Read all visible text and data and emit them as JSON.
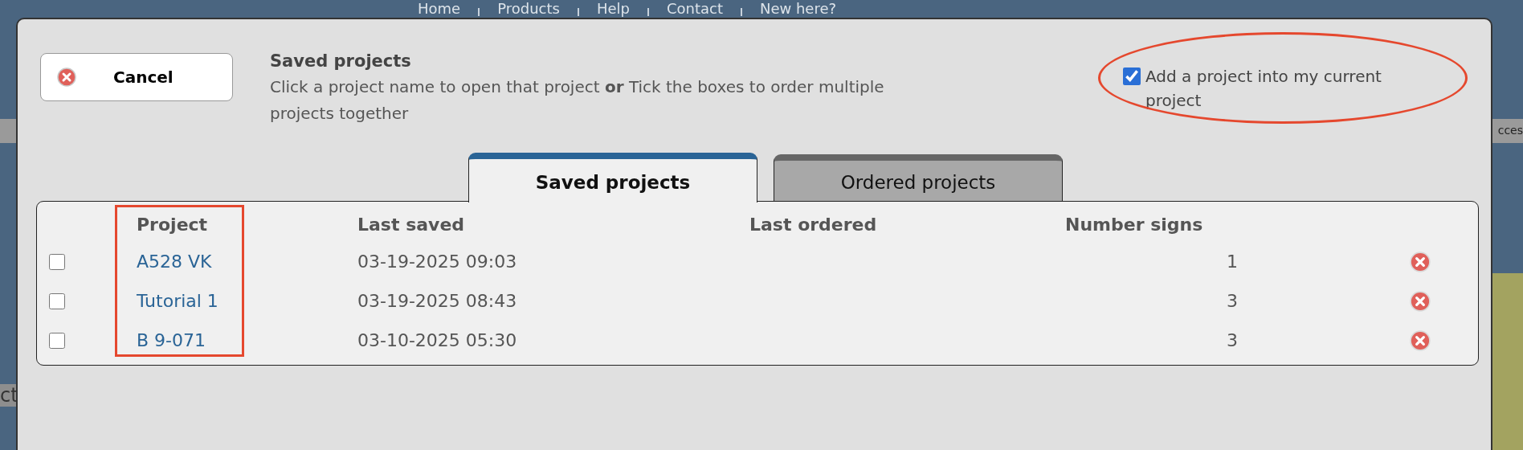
{
  "background_page": {
    "nav": [
      "Home",
      "Products",
      "Help",
      "Contact",
      "New here?"
    ],
    "left_fragment": "ct",
    "right_fragment": "cces"
  },
  "dialog": {
    "cancel_button": "Cancel",
    "title": "Saved projects",
    "description": "Click a project name to open that project **or** Tick the boxes to order multiple projects together",
    "add_to_current": {
      "label": "Add a project into my current project",
      "checked": true
    }
  },
  "tabs": [
    {
      "label": "Saved projects",
      "selected": true
    },
    {
      "label": "Ordered projects",
      "selected": false
    }
  ],
  "table": {
    "columns": [
      "Project",
      "Last saved",
      "Last ordered",
      "Number signs"
    ],
    "rows": [
      {
        "checked": false,
        "project": "A528 VK",
        "last_saved": "03-19-2025 09:03",
        "number_signs": "1"
      },
      {
        "checked": false,
        "project": "Tutorial 1",
        "last_saved": "03-19-2025 08:43",
        "number_signs": "3"
      },
      {
        "checked": false,
        "project": "B 9-071",
        "last_saved": "03-10-2025 05:30",
        "number_signs": "3"
      }
    ]
  }
}
